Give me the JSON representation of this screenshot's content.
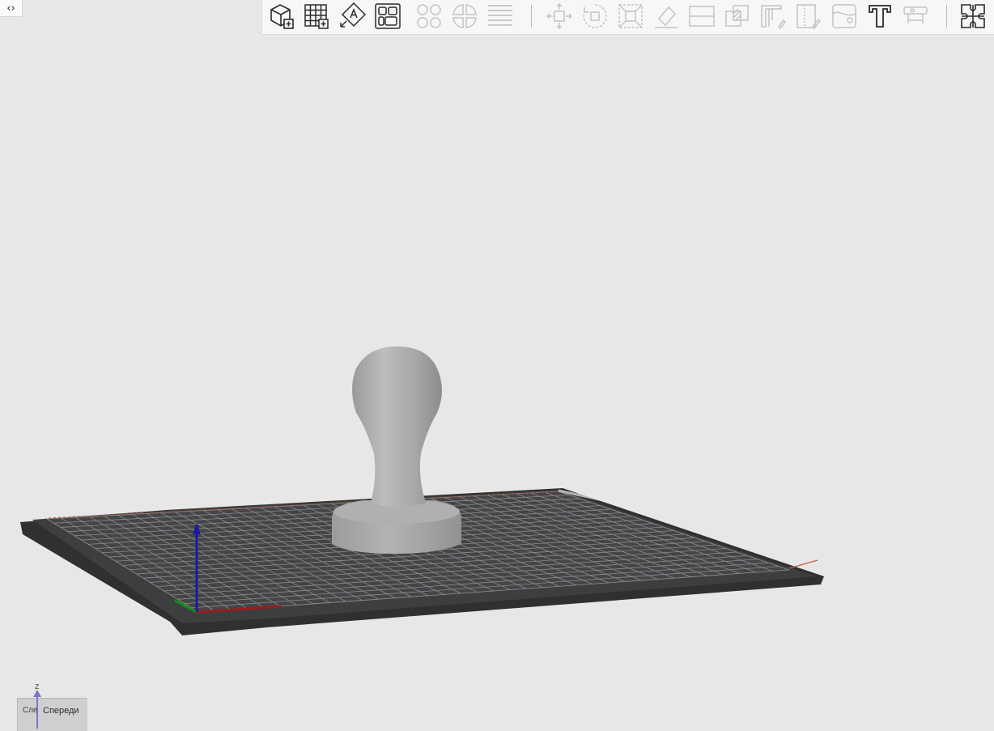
{
  "nav": {
    "collapse_toggle": "‹›"
  },
  "toolbar": {
    "groups": [
      {
        "buttons": [
          {
            "id": "add-object",
            "icon": "add-cube-icon",
            "enabled": true
          },
          {
            "id": "add-plate",
            "icon": "add-grid-plate-icon",
            "enabled": true
          },
          {
            "id": "auto-orient",
            "icon": "auto-orient-icon",
            "enabled": true
          },
          {
            "id": "arrange",
            "icon": "arrange-icon",
            "enabled": true
          },
          {
            "id": "split-objects",
            "icon": "split-to-objects-icon",
            "enabled": false
          },
          {
            "id": "split-parts",
            "icon": "split-to-parts-icon",
            "enabled": false
          },
          {
            "id": "layers",
            "icon": "variable-layer-height-icon",
            "enabled": false
          }
        ]
      },
      {
        "buttons": [
          {
            "id": "move",
            "icon": "move-icon",
            "enabled": false
          },
          {
            "id": "rotate",
            "icon": "rotate-icon",
            "enabled": false
          },
          {
            "id": "scale",
            "icon": "scale-icon",
            "enabled": false
          },
          {
            "id": "lay-on-face",
            "icon": "lay-on-face-icon",
            "enabled": false
          },
          {
            "id": "cut",
            "icon": "cut-icon",
            "enabled": false
          },
          {
            "id": "boolean",
            "icon": "boolean-icon",
            "enabled": false
          },
          {
            "id": "support-paint",
            "icon": "support-paint-icon",
            "enabled": false
          },
          {
            "id": "seam-paint",
            "icon": "seam-paint-icon",
            "enabled": false
          },
          {
            "id": "color-paint",
            "icon": "color-paint-icon",
            "enabled": false
          },
          {
            "id": "text",
            "icon": "text-emboss-icon",
            "enabled": true
          },
          {
            "id": "measure",
            "icon": "measure-icon",
            "enabled": false
          }
        ]
      },
      {
        "buttons": [
          {
            "id": "assembly",
            "icon": "assembly-puzzle-icon",
            "enabled": true
          }
        ]
      }
    ]
  },
  "scene": {
    "object": "tamper",
    "axis_colors": {
      "x": "#a11a1a",
      "y": "#1a8a1a",
      "z": "#1a1aa0"
    }
  },
  "view_cube": {
    "axis_label": "z",
    "face_label": "Спереди",
    "side_label": "Сле"
  },
  "colors": {
    "background": "#e7e7e7",
    "toolbar": "#f7f7f7",
    "plate": "#3a3b3c",
    "object": "#a3a3a3"
  }
}
